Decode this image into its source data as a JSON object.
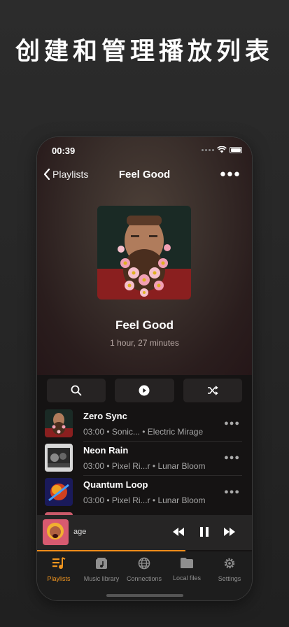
{
  "headline": "创建和管理播放列表",
  "status": {
    "time": "00:39"
  },
  "nav": {
    "back_label": "Playlists",
    "title": "Feel Good"
  },
  "playlist": {
    "title": "Feel Good",
    "duration": "1 hour, 27 minutes"
  },
  "tracks": [
    {
      "title": "Zero Sync",
      "meta": "03:00 • Sonic... • Electric Mirage"
    },
    {
      "title": "Neon Rain",
      "meta": "03:00 • Pixel Ri...r • Lunar Bloom"
    },
    {
      "title": "Quantum Loop",
      "meta": "03:00 • Pixel Ri...r • Lunar Bloom"
    }
  ],
  "now_playing": {
    "partial_title": "age",
    "progress": 0.69
  },
  "tabs": [
    {
      "label": "Playlists",
      "icon": "playlists-icon",
      "active": true
    },
    {
      "label": "Music library",
      "icon": "music-library-icon",
      "active": false
    },
    {
      "label": "Connections",
      "icon": "globe-icon",
      "active": false
    },
    {
      "label": "Local files",
      "icon": "folder-icon",
      "active": false
    },
    {
      "label": "Settings",
      "icon": "gear-icon",
      "active": false
    }
  ],
  "colors": {
    "accent": "#f0951f",
    "background": "#151313",
    "tab_inactive": "#8f8f8f"
  }
}
